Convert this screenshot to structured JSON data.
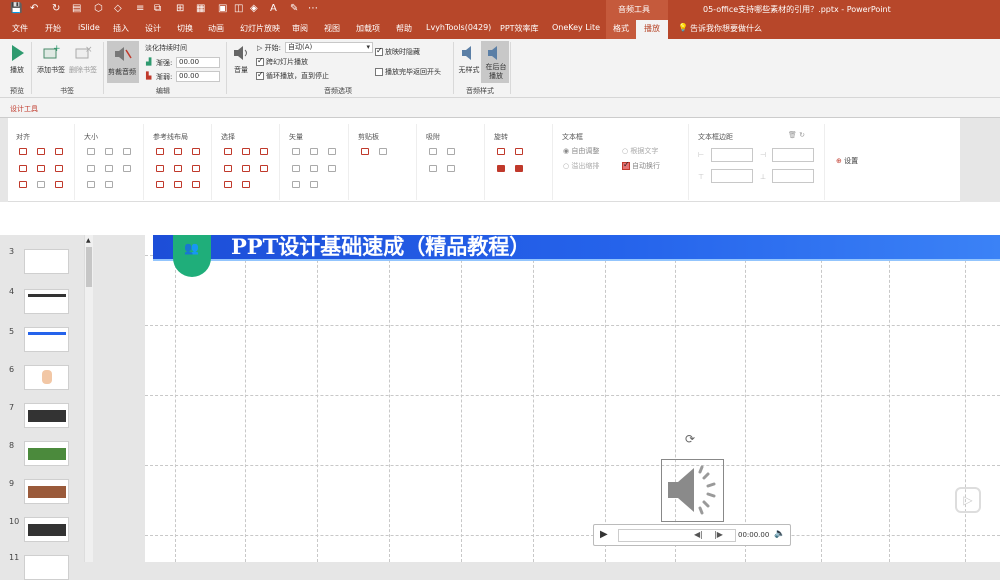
{
  "window": {
    "context_tab_group": "音频工具",
    "title": "05-office支持哪些素材的引用？.pptx  -  PowerPoint"
  },
  "tabs": [
    {
      "label": "文件"
    },
    {
      "label": "开始"
    },
    {
      "label": "iSlide"
    },
    {
      "label": "插入"
    },
    {
      "label": "设计"
    },
    {
      "label": "切换"
    },
    {
      "label": "动画"
    },
    {
      "label": "幻灯片放映"
    },
    {
      "label": "审阅"
    },
    {
      "label": "视图"
    },
    {
      "label": "加载项"
    },
    {
      "label": "帮助"
    },
    {
      "label": "LvyhTools(0429)"
    },
    {
      "label": "PPT效率库"
    },
    {
      "label": "OneKey Lite"
    },
    {
      "label": "格式"
    },
    {
      "label": "播放"
    }
  ],
  "active_tab": "播放",
  "tell_me": "告诉我你想要做什么",
  "ribbon": {
    "preview": {
      "group": "预览",
      "play": "播放"
    },
    "bookmarks": {
      "group": "书签",
      "add": "添加书签",
      "remove": "删除书签"
    },
    "editing": {
      "group": "编辑",
      "trim": "剪裁音频",
      "fade_title": "淡化持续时间",
      "fade_in_label": "渐强:",
      "fade_in_value": "00.00",
      "fade_out_label": "渐弱:",
      "fade_out_value": "00.00"
    },
    "audio_options": {
      "group": "音频选项",
      "volume": "音量",
      "start_label": "开始:",
      "start_value": "自动(A)",
      "across_slides": "跨幻灯片播放",
      "loop": "循环播放，直到停止",
      "hide": "放映时隐藏",
      "rewind": "播放完毕返回开头",
      "across_slides_checked": true,
      "loop_checked": true,
      "hide_checked": true,
      "rewind_checked": false
    },
    "audio_styles": {
      "group": "音频样式",
      "no_style": "无样式",
      "bg_play": "在后台播放"
    }
  },
  "design_tools": {
    "title": "设计工具",
    "groups": [
      "对齐",
      "大小",
      "参考线布局",
      "选择",
      "矢量",
      "剪贴板",
      "吸附",
      "旋转",
      "文本框",
      "文本框边距"
    ],
    "textbox_options": [
      "自由调整",
      "溢出缩排",
      "根据文字",
      "自动换行"
    ],
    "settings": "设置"
  },
  "slide": {
    "title": "PPT设计基础速成（精品教程）",
    "audio_time": "00:00.00"
  },
  "thumbnails": [
    {
      "num": "3"
    },
    {
      "num": "4"
    },
    {
      "num": "5"
    },
    {
      "num": "6"
    },
    {
      "num": "7"
    },
    {
      "num": "8"
    },
    {
      "num": "9"
    },
    {
      "num": "10"
    },
    {
      "num": "11"
    }
  ],
  "colors": {
    "brand": "#b7472a",
    "slide_banner": "#2563eb",
    "badge_green": "#1fae7a"
  }
}
